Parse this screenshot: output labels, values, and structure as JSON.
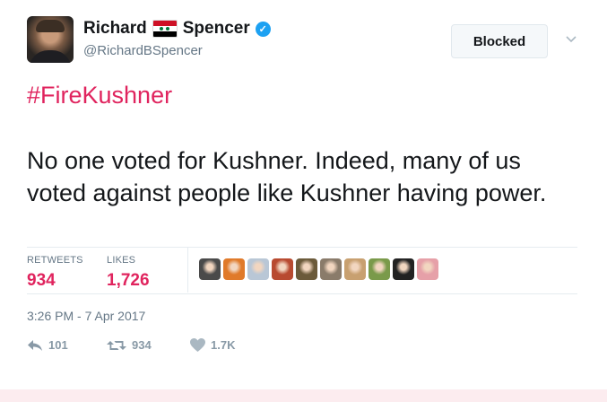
{
  "user": {
    "name_first": "Richard",
    "name_last": "Spencer",
    "flag_icon": "syria-flag-icon",
    "handle": "@RichardBSpencer"
  },
  "header": {
    "blocked_label": "Blocked"
  },
  "tweet": {
    "hashtag": "#FireKushner",
    "text": "No one voted for Kushner. Indeed, many of us voted against people like Kushner having power."
  },
  "stats": {
    "retweets_label": "RETWEETS",
    "retweets_value": "934",
    "likes_label": "LIKES",
    "likes_value": "1,726"
  },
  "likers": [
    {
      "color": "#4a4a4a"
    },
    {
      "color": "#e07a2a"
    },
    {
      "color": "#b9c7d6"
    },
    {
      "color": "#b84a30"
    },
    {
      "color": "#6b5a3a"
    },
    {
      "color": "#8a7b6a"
    },
    {
      "color": "#c8a070"
    },
    {
      "color": "#7a9a4a"
    },
    {
      "color": "#222222"
    },
    {
      "color": "#e6a0a8"
    }
  ],
  "timestamp": "3:26 PM - 7 Apr 2017",
  "actions": {
    "reply_count": "101",
    "retweet_count": "934",
    "like_count": "1.7K"
  },
  "colors": {
    "accent": "#e0245e",
    "verified": "#1da1f2",
    "muted": "#657786"
  }
}
